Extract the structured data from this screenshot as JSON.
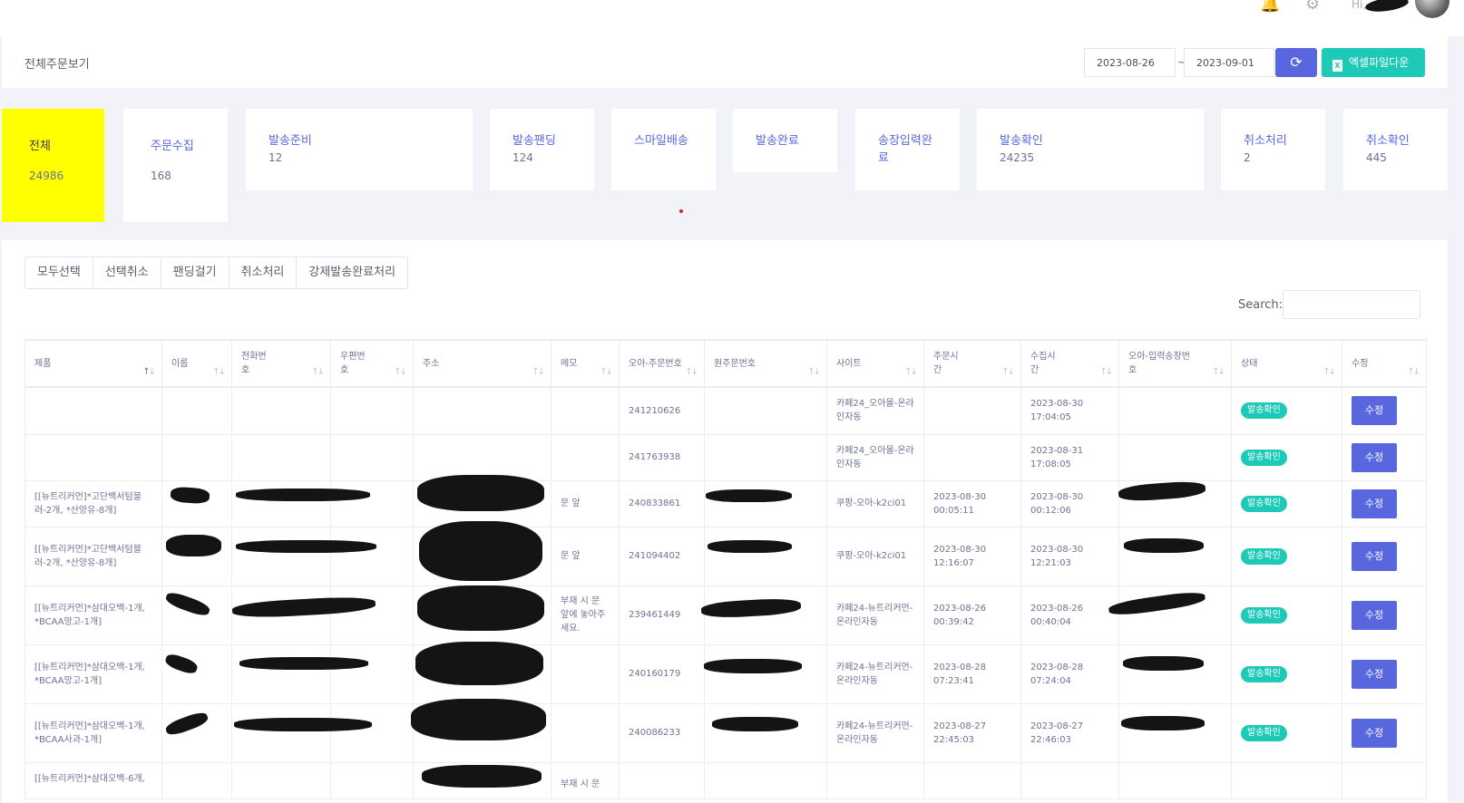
{
  "topbar": {
    "greeting": "Hi,"
  },
  "header": {
    "title": "전체주문보기",
    "date_from": "2023-08-26",
    "date_sep": "~",
    "date_to": "2023-09-01",
    "excel_label": "엑셀파일다운"
  },
  "stats": [
    {
      "label": "전체",
      "count": "24986"
    },
    {
      "label": "주문수집",
      "count": "168"
    },
    {
      "label": "발송준비",
      "count": "12"
    },
    {
      "label": "발송팬딩",
      "count": "124"
    },
    {
      "label": "스마일배송",
      "count": ""
    },
    {
      "label": "발송완료",
      "count": ""
    },
    {
      "label": "송장입력완료",
      "count": ""
    },
    {
      "label": "발송확인",
      "count": "24235"
    },
    {
      "label": "취소처리",
      "count": "2"
    },
    {
      "label": "취소확인",
      "count": "445"
    }
  ],
  "actions": [
    "모두선택",
    "선택취소",
    "팬딩걸기",
    "취소처리",
    "강제발송완료처리"
  ],
  "search": {
    "label": "Search:"
  },
  "table": {
    "columns": [
      "제품",
      "이름",
      "전화번호",
      "우편번호",
      "주소",
      "메모",
      "오아-주문번호",
      "원주문번호",
      "사이트",
      "주문시간",
      "수집시간",
      "오아-입력송장번호",
      "상태",
      "수정"
    ],
    "rows": [
      {
        "product": "",
        "memo": "",
        "oa_order": "241210626",
        "site": "카페24_오아몰-온라인자동",
        "order_time": "",
        "collect_time": "2023-08-30 17:04:05",
        "status": "발송확인",
        "edit": "수정"
      },
      {
        "product": "",
        "memo": "",
        "oa_order": "241763938",
        "site": "카페24_오아몰-온라인자동",
        "order_time": "",
        "collect_time": "2023-08-31 17:08:05",
        "status": "발송확인",
        "edit": "수정"
      },
      {
        "product": "[[뉴트리커먼]*고단백서텀블러-2개, *산양유-8개]",
        "memo": "문 앞",
        "oa_order": "240833861",
        "site": "쿠팡-오아-k2ci01",
        "order_time": "2023-08-30 00:05:11",
        "collect_time": "2023-08-30 00:12:06",
        "status": "발송확인",
        "edit": "수정"
      },
      {
        "product": "[[뉴트리커먼]*고단백서텀블러-2개, *산양유-8개]",
        "memo": "문 앞",
        "oa_order": "241094402",
        "site": "쿠팡-오아-k2ci01",
        "order_time": "2023-08-30 12:16:07",
        "collect_time": "2023-08-30 12:21:03",
        "status": "발송확인",
        "edit": "수정"
      },
      {
        "product": "[[뉴트리커먼]*삼대오백-1개, *BCAA망고-1개]",
        "memo": "부재 시 문 앞에 놓아주세요.",
        "oa_order": "239461449",
        "site": "카페24-뉴트리커먼-온라인자동",
        "order_time": "2023-08-26 00:39:42",
        "collect_time": "2023-08-26 00:40:04",
        "status": "발송확인",
        "edit": "수정"
      },
      {
        "product": "[[뉴트리커먼]*삼대오백-1개, *BCAA망고-1개]",
        "memo": "",
        "oa_order": "240160179",
        "site": "카페24-뉴트리커먼-온라인자동",
        "order_time": "2023-08-28 07:23:41",
        "collect_time": "2023-08-28 07:24:04",
        "status": "발송확인",
        "edit": "수정"
      },
      {
        "product": "[[뉴트리커먼]*삼대오백-1개, *BCAA사과-1개]",
        "memo": "",
        "oa_order": "240086233",
        "site": "카페24-뉴트리커먼-온라인자동",
        "order_time": "2023-08-27 22:45:03",
        "collect_time": "2023-08-27 22:46:03",
        "status": "발송확인",
        "edit": "수정"
      },
      {
        "product": "[[뉴트리커먼]*삼대오백-6개,",
        "memo": "부재 시 문",
        "oa_order": "",
        "site": "",
        "order_time": "",
        "collect_time": "",
        "status": "",
        "edit": ""
      }
    ]
  }
}
